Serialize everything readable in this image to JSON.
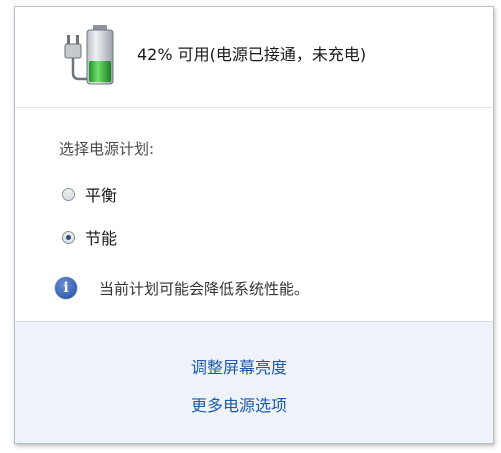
{
  "status": {
    "text": "42% 可用(电源已接通，未充电)",
    "battery_percent": 42,
    "icon": "battery-plugged-icon"
  },
  "plans": {
    "label": "选择电源计划:",
    "options": [
      {
        "label": "平衡",
        "selected": false
      },
      {
        "label": "节能",
        "selected": true
      }
    ]
  },
  "info": {
    "icon": "info-icon",
    "text": "当前计划可能会降低系统性能。"
  },
  "links": {
    "brightness": "调整屏幕亮度",
    "more_options": "更多电源选项"
  },
  "colors": {
    "link": "#1f5ba8",
    "footer_bg": "#eef3f9",
    "battery_fill": "#33c23a"
  }
}
